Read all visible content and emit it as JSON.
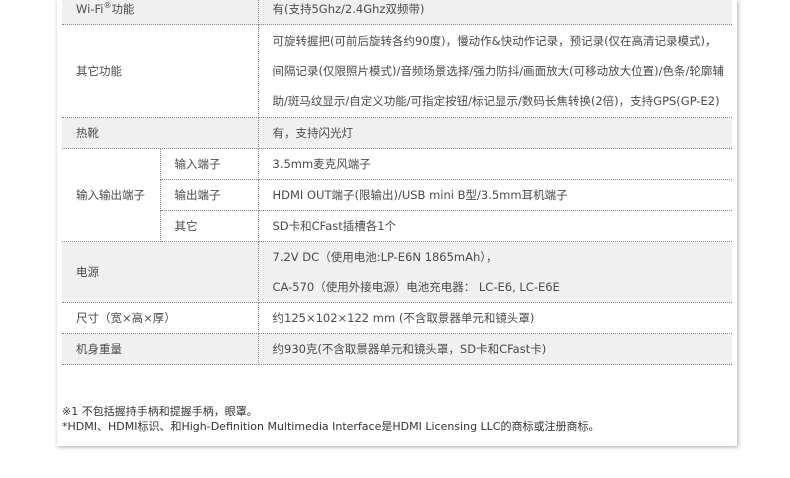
{
  "rows": {
    "wifi": {
      "label_pre": "Wi-Fi",
      "label_sup": "®",
      "label_post": "功能",
      "value": "有(支持5Ghz/2.4Ghz双频带)"
    },
    "other": {
      "label": "其它功能",
      "value": "可旋转握把(可前后旋转各约90度)，慢动作&快动作记录，预记录(仅在高清记录模式)，间隔记录(仅限照片模式)/音频场景选择/强力防抖/画面放大(可移动放大位置)/色条/轮廓辅助/斑马纹显示/自定义功能/可指定按钮/标记显示/数码长焦转换(2倍)，支持GPS(GP-E2)"
    },
    "hotshoe": {
      "label": "热靴",
      "value": "有，支持闪光灯"
    },
    "io": {
      "label": "输入输出端子",
      "input_label": "输入端子",
      "input_value": "3.5mm麦克风端子",
      "output_label": "输出端子",
      "output_value": "HDMI OUT端子(限输出)/USB mini B型/3.5mm耳机端子",
      "other_label": "其它",
      "other_value": "SD卡和CFast插槽各1个"
    },
    "power": {
      "label": "电源",
      "value_line1": "7.2V DC（使用电池:LP-E6N 1865mAh），",
      "value_line2": "CA-570（使用外接电源）电池充电器： LC-E6, LC-E6E"
    },
    "size": {
      "label": "尺寸（宽×高×厚）",
      "value": "约125×102×122 mm (不含取景器单元和镜头罩)"
    },
    "weight": {
      "label": "机身重量",
      "value": "约930克(不含取景器单元和镜头罩，SD卡和CFast卡)"
    }
  },
  "notes": {
    "line1": "※1 不包括握持手柄和提握手柄，眼罩。",
    "line2": "*HDMI、HDMI标识、和High-Definition Multimedia Interface是HDMI Licensing LLC的商标或注册商标。"
  }
}
